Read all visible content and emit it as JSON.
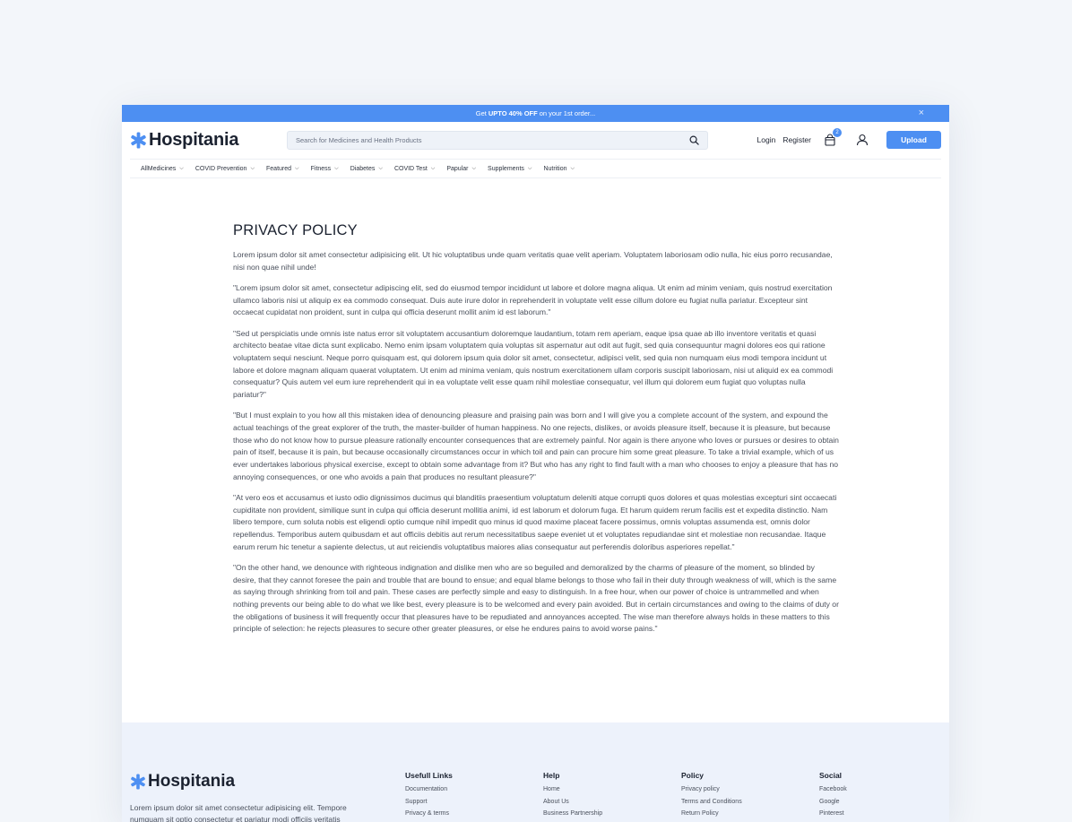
{
  "promo": {
    "prefix": "Get",
    "highlight": "UPTO 40% OFF",
    "suffix": "on your 1st order...",
    "close_glyph": "×"
  },
  "header": {
    "logo_text": "Hospitania",
    "search_placeholder": "Search for Medicines and Health Products",
    "login": "Login",
    "register": "Register",
    "cart_count": "2",
    "upload_label": "Upload"
  },
  "nav": {
    "items": [
      {
        "label": "AllMedicines"
      },
      {
        "label": "COVID Prevention"
      },
      {
        "label": "Featured"
      },
      {
        "label": "Fitness"
      },
      {
        "label": "Diabetes"
      },
      {
        "label": "COVID Test"
      },
      {
        "label": "Papular"
      },
      {
        "label": "Supplements"
      },
      {
        "label": "Nutrition"
      }
    ]
  },
  "page": {
    "title": "PRIVACY POLICY",
    "paragraphs": [
      "Lorem ipsum dolor sit amet consectetur adipisicing elit. Ut hic voluptatibus unde quam veritatis quae velit aperiam. Voluptatem laboriosam odio nulla, hic eius porro recusandae, nisi non quae nihil unde!",
      "\"Lorem ipsum dolor sit amet, consectetur adipiscing elit, sed do eiusmod tempor incididunt ut labore et dolore magna aliqua. Ut enim ad minim veniam, quis nostrud exercitation ullamco laboris nisi ut aliquip ex ea commodo consequat. Duis aute irure dolor in reprehenderit in voluptate velit esse cillum dolore eu fugiat nulla pariatur. Excepteur sint occaecat cupidatat non proident, sunt in culpa qui officia deserunt mollit anim id est laborum.\"",
      "\"Sed ut perspiciatis unde omnis iste natus error sit voluptatem accusantium doloremque laudantium, totam rem aperiam, eaque ipsa quae ab illo inventore veritatis et quasi architecto beatae vitae dicta sunt explicabo. Nemo enim ipsam voluptatem quia voluptas sit aspernatur aut odit aut fugit, sed quia consequuntur magni dolores eos qui ratione voluptatem sequi nesciunt. Neque porro quisquam est, qui dolorem ipsum quia dolor sit amet, consectetur, adipisci velit, sed quia non numquam eius modi tempora incidunt ut labore et dolore magnam aliquam quaerat voluptatem. Ut enim ad minima veniam, quis nostrum exercitationem ullam corporis suscipit laboriosam, nisi ut aliquid ex ea commodi consequatur? Quis autem vel eum iure reprehenderit qui in ea voluptate velit esse quam nihil molestiae consequatur, vel illum qui dolorem eum fugiat quo voluptas nulla pariatur?\"",
      "\"But I must explain to you how all this mistaken idea of denouncing pleasure and praising pain was born and I will give you a complete account of the system, and expound the actual teachings of the great explorer of the truth, the master-builder of human happiness. No one rejects, dislikes, or avoids pleasure itself, because it is pleasure, but because those who do not know how to pursue pleasure rationally encounter consequences that are extremely painful. Nor again is there anyone who loves or pursues or desires to obtain pain of itself, because it is pain, but because occasionally circumstances occur in which toil and pain can procure him some great pleasure. To take a trivial example, which of us ever undertakes laborious physical exercise, except to obtain some advantage from it? But who has any right to find fault with a man who chooses to enjoy a pleasure that has no annoying consequences, or one who avoids a pain that produces no resultant pleasure?\"",
      "\"At vero eos et accusamus et iusto odio dignissimos ducimus qui blanditiis praesentium voluptatum deleniti atque corrupti quos dolores et quas molestias excepturi sint occaecati cupiditate non provident, similique sunt in culpa qui officia deserunt mollitia animi, id est laborum et dolorum fuga. Et harum quidem rerum facilis est et expedita distinctio. Nam libero tempore, cum soluta nobis est eligendi optio cumque nihil impedit quo minus id quod maxime placeat facere possimus, omnis voluptas assumenda est, omnis dolor repellendus. Temporibus autem quibusdam et aut officiis debitis aut rerum necessitatibus saepe eveniet ut et voluptates repudiandae sint et molestiae non recusandae. Itaque earum rerum hic tenetur a sapiente delectus, ut aut reiciendis voluptatibus maiores alias consequatur aut perferendis doloribus asperiores repellat.\"",
      "\"On the other hand, we denounce with righteous indignation and dislike men who are so beguiled and demoralized by the charms of pleasure of the moment, so blinded by desire, that they cannot foresee the pain and trouble that are bound to ensue; and equal blame belongs to those who fail in their duty through weakness of will, which is the same as saying through shrinking from toil and pain. These cases are perfectly simple and easy to distinguish. In a free hour, when our power of choice is untrammelled and when nothing prevents our being able to do what we like best, every pleasure is to be welcomed and every pain avoided. But in certain circumstances and owing to the claims of duty or the obligations of business it will frequently occur that pleasures have to be repudiated and annoyances accepted. The wise man therefore always holds in these matters to this principle of selection: he rejects pleasures to secure other greater pleasures, or else he endures pains to avoid worse pains.\""
    ]
  },
  "footer": {
    "logo_text": "Hospitania",
    "description": "Lorem ipsum dolor sit amet consectetur adipisicing elit. Tempore numquam sit optio consectetur et pariatur modi officiis veritatis",
    "columns": [
      {
        "title": "Usefull Links",
        "links": [
          "Documentation",
          "Support",
          "Privacy & terms"
        ]
      },
      {
        "title": "Help",
        "links": [
          "Home",
          "About Us",
          "Business Partnership"
        ]
      },
      {
        "title": "Policy",
        "links": [
          "Privacy policy",
          "Terms and Conditions",
          "Return Policy"
        ]
      },
      {
        "title": "Social",
        "links": [
          "Facebook",
          "Google",
          "Pinterest"
        ]
      }
    ]
  },
  "colors": {
    "accent": "#4d8ff2",
    "page_bg": "#f3f6fa",
    "footer_bg": "#edf2fb"
  },
  "icons": {
    "logo": "asterisk-cross-icon",
    "search": "search-icon",
    "cart": "shopping-bag-icon",
    "user": "user-icon",
    "close": "close-icon",
    "chevron": "chevron-down-icon"
  }
}
